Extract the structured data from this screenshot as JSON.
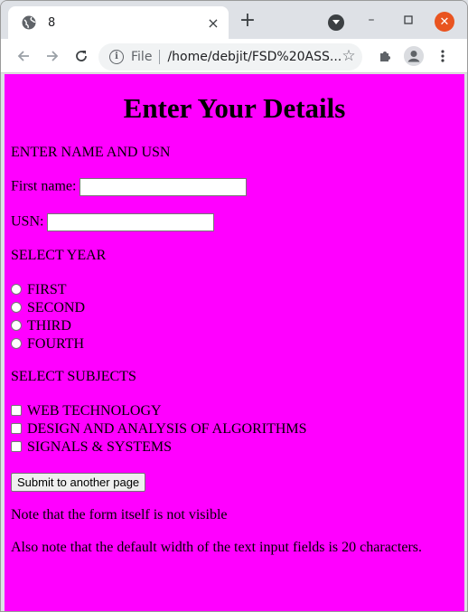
{
  "browser": {
    "tab_title": "8",
    "address_scheme": "File",
    "address_url": "/home/debjit/FSD%20ASS...",
    "new_tab_symbol": "+",
    "tab_close_symbol": "×",
    "minimize_symbol": "–",
    "close_symbol": "✕"
  },
  "form": {
    "heading": "Enter Your Details",
    "name_usn_label": "ENTER NAME AND USN",
    "first_name_label": "First name:",
    "first_name_value": "",
    "usn_label": "USN:",
    "usn_value": "",
    "select_year_label": "SELECT YEAR",
    "years": [
      "FIRST",
      "SECOND",
      "THIRD",
      "FOURTH"
    ],
    "select_subjects_label": "SELECT SUBJECTS",
    "subjects": [
      "WEB TECHNOLOGY",
      "DESIGN AND ANALYSIS OF ALGORITHMS",
      "SIGNALS & SYSTEMS"
    ],
    "submit_label": "Submit to another page",
    "note1": "Note that the form itself is not visible",
    "note2": "Also note that the default width of the text input fields is 20 characters."
  },
  "colors": {
    "page_background": "#ff00ff",
    "close_button": "#e95420"
  }
}
